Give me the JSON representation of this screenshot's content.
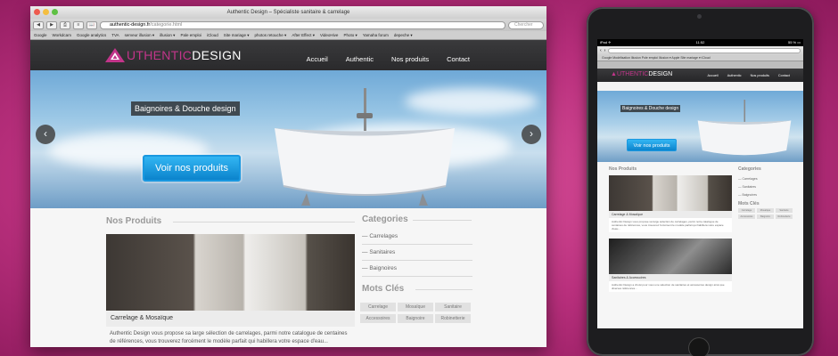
{
  "browser": {
    "window_title": "Authentic Design – Spécialiste sanitaire & carrelage",
    "url_domain": "authentic-design.fr",
    "url_path": "/categorie.html",
    "search_placeholder": "Chercher",
    "bookmarks": [
      "Google",
      "Workdcam",
      "Google analytics",
      "TVA",
      "serveur illusion ▾",
      "illusion ▾",
      "Pale emploi",
      "iCloud",
      "Site mariage ▾",
      "photos retouche ▾",
      "After Effect ▾",
      "VideoHive",
      "Photo ▾",
      "Yamaha forum",
      "depeche ▾"
    ]
  },
  "site": {
    "logo_prefix": "UTHENTIC",
    "logo_suffix": "DESIGN",
    "nav": [
      "Accueil",
      "Authentic",
      "Nos produits",
      "Contact"
    ],
    "hero_caption": "Baignoires & Douche design",
    "hero_cta": "Voir nos produits",
    "products_heading": "Nos Produits",
    "product_title": "Carrelage & Mosaïque",
    "product_desc": "Authentic Design vous propose sa large sélection de carrelages, parmi notre catalogue de centaines de références, vous trouverez forcément le modèle parfait qui habillera votre espace d'eau...",
    "categories_heading": "Categories",
    "categories": [
      "Carrelages",
      "Sanitaires",
      "Baignoires"
    ],
    "tags_heading": "Mots Clés",
    "tags": [
      "Carrelage",
      "Mosaïque",
      "Sanitaire",
      "Accessoires",
      "Baignoire",
      "Robinetterie"
    ]
  },
  "ipad": {
    "status_left": "iPad ✈",
    "status_time": "11:52",
    "status_right": "55 % ▭",
    "bookmarks": "Google   Modélisation Illusion   Pole emploi   Illusion ▾   Apple   Site mariage ▾   iCloud",
    "product2_title": "Sanitaires & Accessoires",
    "product1_desc": "Authentic Design vous propose sa large sélection de carrelages, parmi notre catalogue de centaines de références, vous trouverez forcément le modèle parfait qui habillera votre espace d'eau...",
    "product2_desc": "Authentic Design a choisi pour vous une sélection de sanitaires et accessoires design ainsi que diverses références..."
  },
  "colors": {
    "brand": "#c2358a",
    "cta": "#1b9be3",
    "background": "#c13a85"
  }
}
